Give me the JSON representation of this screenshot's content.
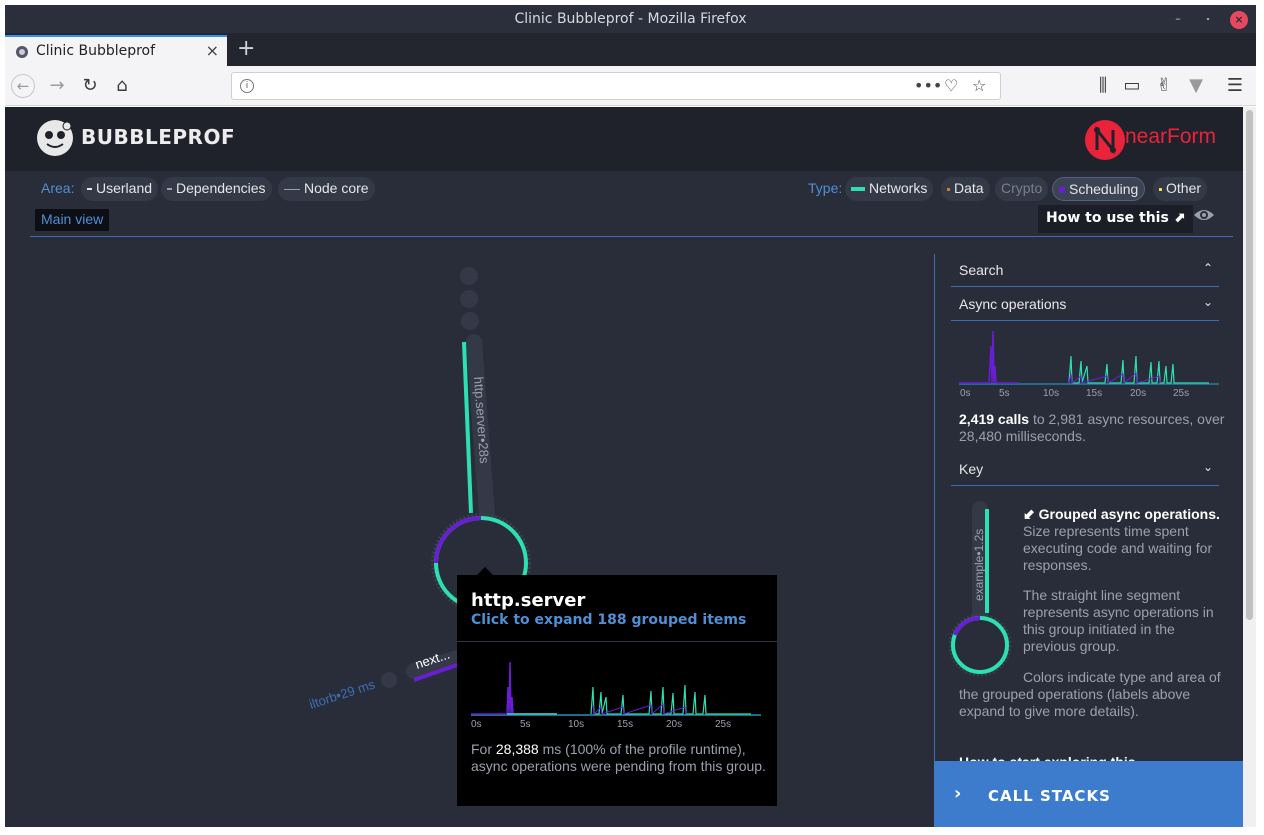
{
  "window": {
    "title": "Clinic Bubbleprof - Mozilla Firefox"
  },
  "tab": {
    "label": "Clinic Bubbleprof",
    "close": "×",
    "new_tab": "+"
  },
  "navbar": {
    "url": ""
  },
  "header": {
    "logo_text": "BUBBLEPROF",
    "brand": "nearForm"
  },
  "filters": {
    "area_label": "Area:",
    "area": [
      {
        "label": "Userland"
      },
      {
        "label": "Dependencies"
      },
      {
        "label": "Node core"
      }
    ],
    "type_label": "Type:",
    "type": [
      {
        "label": "Networks",
        "color": "#2de0b1"
      },
      {
        "label": "Data",
        "color": "#d07a2a"
      },
      {
        "label": "Crypto",
        "color": "#7a7f8c"
      },
      {
        "label": "Scheduling",
        "color": "#6a1ed4"
      },
      {
        "label": "Other",
        "color": "#f2e04a"
      }
    ]
  },
  "main_view": "Main view",
  "how_to": "How to use this",
  "graph": {
    "main_label": "http.server•28s",
    "side_label": "next...",
    "side_label2": "iltorb•29 ms"
  },
  "sidebar": {
    "search": "Search",
    "async_ops": "Async operations",
    "ticks": [
      "0s",
      "5s",
      "10s",
      "15s",
      "20s",
      "25s"
    ],
    "summary_calls": "2,419 calls",
    "summary_rest": " to 2,981 async resources, over 28,480 milliseconds.",
    "key": "Key",
    "key_bubble_label": "example•1.2s",
    "key_p1_bold": "Grouped async operations.",
    "key_p1_rest": " Size represents time spent executing code and waiting for responses.",
    "key_p2": "The straight line segment represents async operations in this group initiated in the previous group.",
    "key_p3": "Colors indicate type and area of the grouped operations (labels above expand to give more details).",
    "explore_heading": "How to start exploring this"
  },
  "call_stacks": "CALL STACKS",
  "tooltip": {
    "title": "http.server",
    "subtitle": "Click to expand 188 grouped items",
    "ticks": [
      "0s",
      "5s",
      "10s",
      "15s",
      "20s",
      "25s"
    ],
    "body_prefix": "For ",
    "body_value": "28,388",
    "body_suffix": " ms (100% of the profile runtime), async operations were pending from this group."
  },
  "colors": {
    "background": "#292d39",
    "header": "#1f222b",
    "accent_blue": "#3d7ccc",
    "networks": "#2de0b1",
    "scheduling": "#6a1ed4"
  }
}
